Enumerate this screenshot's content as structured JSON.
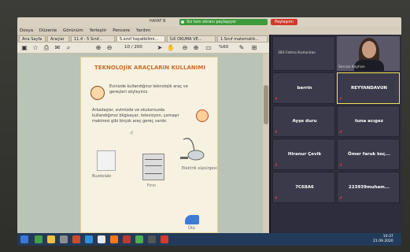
{
  "window": {
    "title": "HAYAT B",
    "meeting_bar": "Siz tam ekranı paylaşıyor",
    "stop_share": "Paylaşımı Durdur"
  },
  "menu": [
    "Dosya",
    "Düzenle",
    "Görünüm",
    "Yerleştir",
    "Pencere",
    "Yardım"
  ],
  "tabs": [
    {
      "label": "Ana Sayfa"
    },
    {
      "label": "Araçlar"
    },
    {
      "label": "11.4 - 5 Sınıf..."
    },
    {
      "label": "5.sınıf hayatbilimi..."
    },
    {
      "label": "İLK OKUMA VE..."
    },
    {
      "label": "1.Sınıf matematik..."
    }
  ],
  "toolbar": {
    "page": "10 / 200",
    "zoom": "%60"
  },
  "document": {
    "title": "TEKNOLOJİK ARAÇLARIN KULLANIMI",
    "question": "Evinizde kullandığınız teknolojik araç ve gereçleri söyleyiniz.",
    "paragraph": "Arkadaşlar, evimizde ve okulumuzda kullandığımız bilgisayar, televizyon, çamaşır makinesi gibi birçok araç gereç vardır.",
    "labels": {
      "calculator": "Buzdolabı",
      "oven": "Fırın",
      "vacuum": "Elektrik süpürgesi",
      "iron": "Ütü"
    }
  },
  "meeting": {
    "participants_count": "383 Fatma Kızılarslan",
    "host_name": "Sercan Kayhan",
    "tiles": [
      {
        "name": "berrin"
      },
      {
        "name": "REYYANDAVUN"
      },
      {
        "name": "Ayşe duru"
      },
      {
        "name": "tuna acıgez"
      },
      {
        "name": "Hiranur Çevik"
      },
      {
        "name": "Ömer faruk koç..."
      },
      {
        "name": "7C68A6"
      },
      {
        "name": "223939muham..."
      }
    ]
  },
  "taskbar": {
    "time": "10:37",
    "date": "21.09.2020"
  }
}
